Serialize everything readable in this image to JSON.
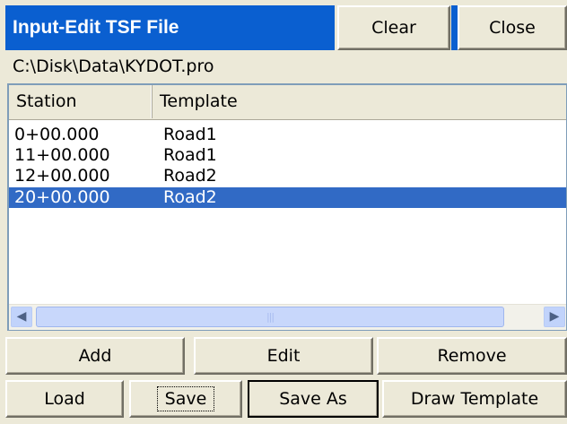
{
  "window": {
    "title": "Input-Edit TSF File",
    "clear_label": "Clear",
    "close_label": "Close",
    "file_path": "C:\\Disk\\Data\\KYDOT.pro",
    "title_color": "#0a5fd0",
    "selection_color": "#316ac5"
  },
  "list": {
    "columns": [
      "Station",
      "Template"
    ],
    "rows": [
      {
        "station": "0+00.000",
        "template": "Road1",
        "selected": false
      },
      {
        "station": "11+00.000",
        "template": "Road1",
        "selected": false
      },
      {
        "station": "12+00.000",
        "template": "Road2",
        "selected": false
      },
      {
        "station": "20+00.000",
        "template": "Road2",
        "selected": true
      }
    ],
    "scrollbar_thumb_glyph": "|||",
    "scroll_left_icon": "scroll-left-arrow-icon",
    "scroll_right_icon": "scroll-right-arrow-icon"
  },
  "buttons": {
    "add": "Add",
    "edit": "Edit",
    "remove": "Remove",
    "load": "Load",
    "save": "Save",
    "save_as": "Save As",
    "draw_template": "Draw Template"
  }
}
